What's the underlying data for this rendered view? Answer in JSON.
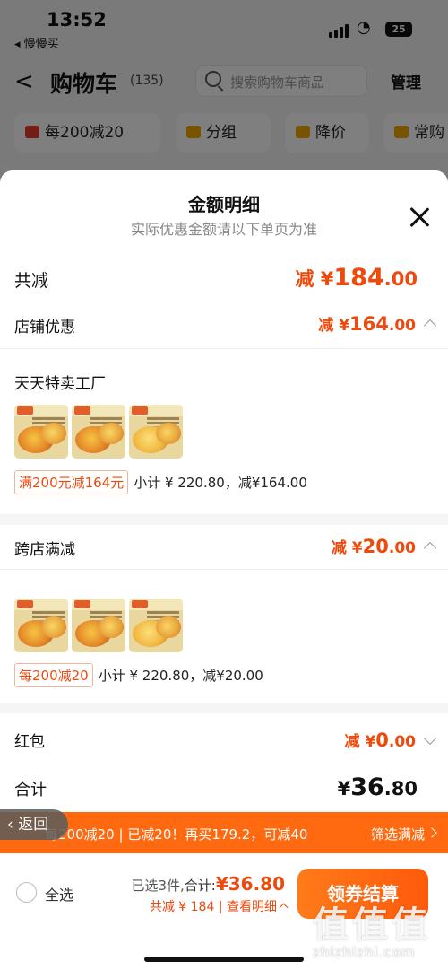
{
  "status_bar": {
    "time": "13:52",
    "back_app": "◂ 慢慢买",
    "battery": "25"
  },
  "cart_header": {
    "back_glyph": "<",
    "title": "购物车",
    "count": "(135)",
    "search_placeholder": "搜索购物车商品",
    "manage": "管理"
  },
  "filter_chips": [
    {
      "label": "每200减20",
      "icon": "coupon-icon",
      "color": "#e53a2f"
    },
    {
      "label": "分组",
      "icon": "folder-icon",
      "color": "#f0a800"
    },
    {
      "label": "降价",
      "icon": "arrow-down-icon",
      "color": "#f0a800"
    },
    {
      "label": "常购",
      "icon": "cart-icon",
      "color": "#f0a800"
    }
  ],
  "sheet": {
    "title": "金额明细",
    "subtitle": "实际优惠金额请以下单页为准",
    "total_discount": {
      "label": "共减",
      "prefix": "减 ¥",
      "int": "184",
      "dec": ".00"
    },
    "store_discount": {
      "label": "店铺优惠",
      "prefix": "减 ¥",
      "int": "164",
      "dec": ".00"
    },
    "store": {
      "name": "天天特卖工厂",
      "promo_tag": "满200元减164元",
      "promo_text": "小计 ¥ 220.80，减¥164.00"
    },
    "cross_store": {
      "label": "跨店满减",
      "prefix": "减 ¥",
      "int": "20",
      "dec": ".00"
    },
    "cross_items": {
      "promo_tag": "每200减20",
      "promo_text": "小计 ¥ 220.80，减¥20.00"
    },
    "red_packet": {
      "label": "红包",
      "prefix": "减 ¥",
      "int": "0",
      "dec": ".00"
    },
    "subtotal": {
      "label": "合计",
      "prefix": "¥",
      "int": "36",
      "dec": ".80"
    }
  },
  "promo_bar": {
    "text": "每200减20 | 已减20！再买179.2，可减40",
    "link": "筛选满减"
  },
  "back_float": "‹ 返回",
  "bottom": {
    "select_all": "全选",
    "selected_count": "已选3件,",
    "total_label": "合计:",
    "total_prefix": "¥",
    "total_value": "36.80",
    "savings": "共减 ¥ 184 | 查看明细",
    "checkout": "领券结算"
  },
  "watermark": {
    "logo": "值值值",
    "url": "zhizhizhi.com"
  },
  "colors": {
    "accent": "#ee4a0d",
    "promo_bar": "#ff6a10",
    "button": "#ff5a0a"
  }
}
